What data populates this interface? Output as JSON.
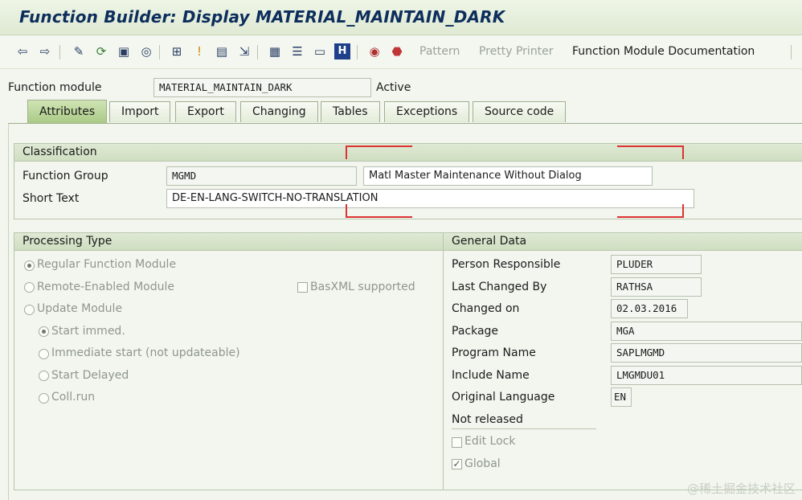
{
  "window": {
    "title": "Function Builder: Display MATERIAL_MAINTAIN_DARK"
  },
  "toolbar": {
    "icons": [
      "back-arrow-icon",
      "forward-arrow-icon",
      "edit-pencil-icon",
      "display-change-icon",
      "object-list-icon",
      "where-used-icon",
      "test-icon",
      "debug-icon",
      "navigate-icon",
      "other-object-icon",
      "hierarchy-icon",
      "layout-icon",
      "display-list-icon",
      "info-icon",
      "activate-icon",
      "stop-icon"
    ],
    "pattern_label": "Pattern",
    "pretty_printer_label": "Pretty Printer",
    "documentation_label": "Function Module Documentation"
  },
  "header": {
    "function_module_label": "Function module",
    "function_module_value": "MATERIAL_MAINTAIN_DARK",
    "status": "Active"
  },
  "tabs": [
    {
      "label": "Attributes",
      "active": true
    },
    {
      "label": "Import"
    },
    {
      "label": "Export"
    },
    {
      "label": "Changing"
    },
    {
      "label": "Tables"
    },
    {
      "label": "Exceptions"
    },
    {
      "label": "Source code"
    }
  ],
  "classification": {
    "title": "Classification",
    "function_group_label": "Function Group",
    "function_group_value": "MGMD",
    "function_group_description": "Matl Master Maintenance Without Dialog",
    "short_text_label": "Short Text",
    "short_text_value": "DE-EN-LANG-SWITCH-NO-TRANSLATION"
  },
  "processing": {
    "title": "Processing Type",
    "regular": "Regular Function Module",
    "remote": "Remote-Enabled Module",
    "basxml": "BasXML supported",
    "update": "Update Module",
    "start_immed": "Start immed.",
    "immediate_start": "Immediate start (not updateable)",
    "start_delayed": "Start Delayed",
    "coll_run": "Coll.run"
  },
  "general": {
    "title": "General Data",
    "person_label": "Person Responsible",
    "person_value": "PLUDER",
    "last_changed_label": "Last Changed By",
    "last_changed_value": "RATHSA",
    "changed_on_label": "Changed on",
    "changed_on_value": "02.03.2016",
    "package_label": "Package",
    "package_value": "MGA",
    "program_label": "Program Name",
    "program_value": "SAPLMGMD",
    "include_label": "Include Name",
    "include_value": "LMGMDU01",
    "language_label": "Original Language",
    "language_value": "EN",
    "release_status": "Not released",
    "edit_lock_label": "Edit Lock",
    "global_label": "Global"
  },
  "watermark": "@稀土掘金技术社区",
  "colors": {
    "accent": "#0d2e5c",
    "annotation_red": "#d33333",
    "active_tab": "#a9c985"
  }
}
